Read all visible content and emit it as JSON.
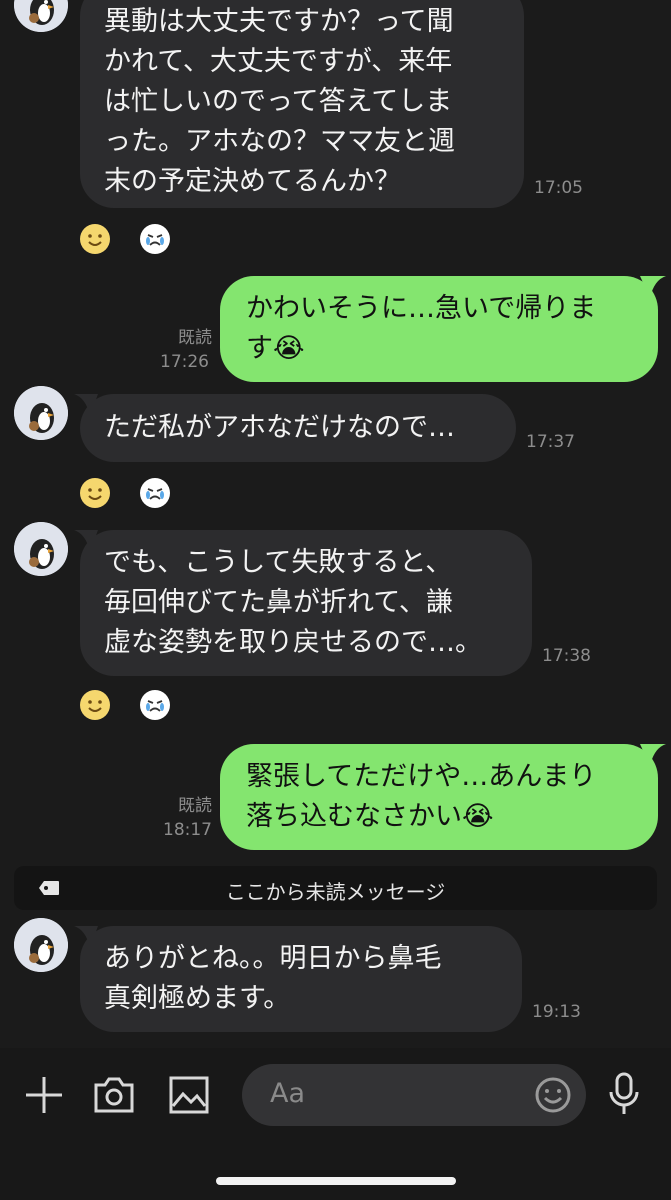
{
  "messages": [
    {
      "text": "異動は大丈夫ですか？って聞\nかれて、大丈夫ですが、来年\nは忙しいのでって答えてしま\nった。アホなの？ママ友と週\n末の予定決めてるんか？",
      "time": "17:05"
    },
    {
      "text": "かわいそうに…急いで帰りま\nす😭",
      "read": "既読",
      "time": "17:26"
    },
    {
      "text": "ただ私がアホなだけなので…",
      "time": "17:37"
    },
    {
      "text": "でも、こうして失敗すると、\n毎回伸びてた鼻が折れて、謙\n虚な姿勢を取り戻せるので…。",
      "time": "17:38"
    },
    {
      "text": "緊張してただけや…あんまり\n落ち込むなさかい😭",
      "read": "既読",
      "time": "18:17"
    },
    {
      "text": "ありがとね。。明日から鼻毛\n真剣極めます。",
      "time": "19:13"
    }
  ],
  "unread_divider": "ここから未読メッセージ",
  "input": {
    "placeholder": "Aa"
  },
  "colors": {
    "background": "#1b1b1b",
    "incoming_bubble": "#2c2c2e",
    "outgoing_bubble": "#84e56f"
  },
  "icons": {
    "plus": "plus-icon",
    "camera": "camera-icon",
    "image": "image-icon",
    "emoji": "emoji-icon",
    "mic": "mic-icon",
    "tag": "tag-icon",
    "reaction_smile": "smile-reaction-icon",
    "reaction_cry": "crying-reaction-icon"
  }
}
